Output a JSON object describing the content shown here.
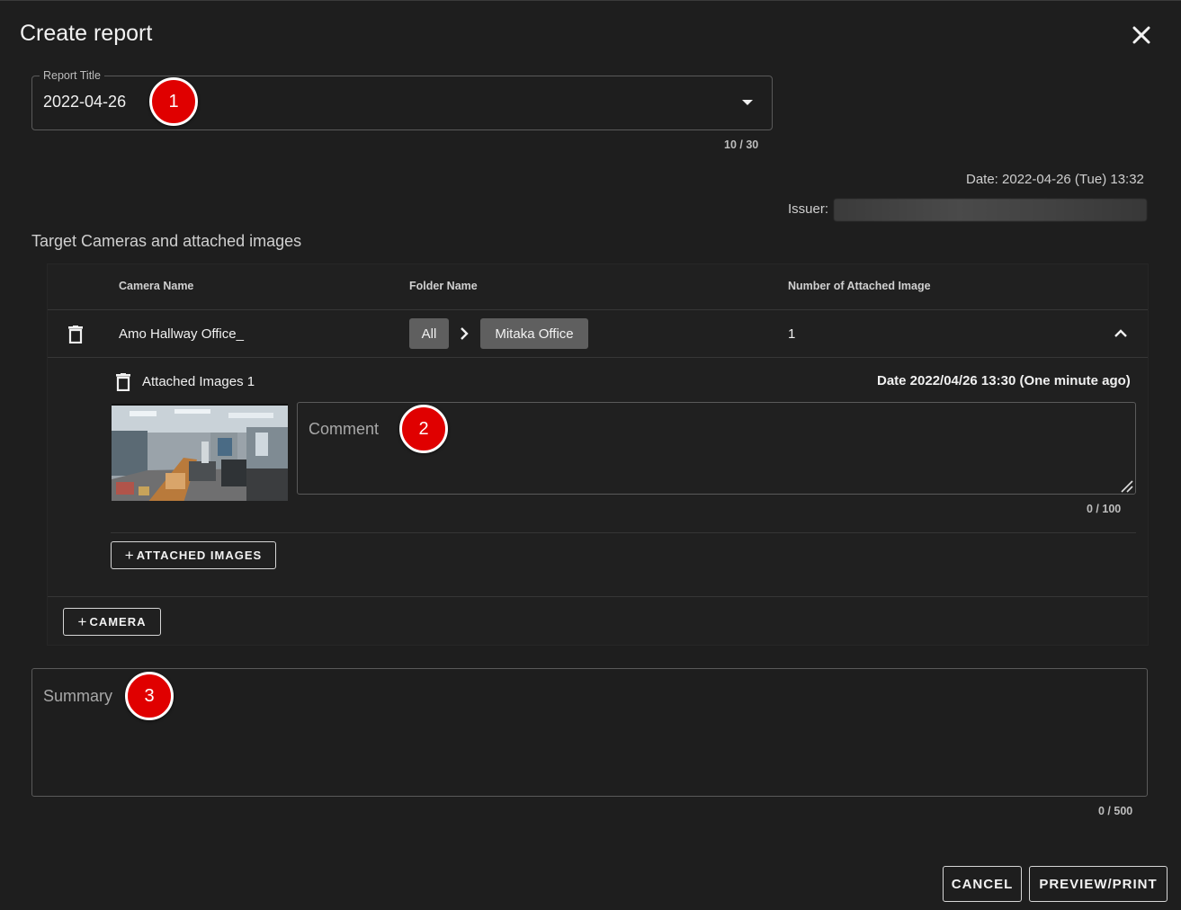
{
  "dialog": {
    "title": "Create report"
  },
  "report_title": {
    "legend": "Report Title",
    "value": "2022-04-26",
    "counter": "10 / 30"
  },
  "meta": {
    "date": "Date: 2022-04-26 (Tue) 13:32",
    "issuer_label": "Issuer:"
  },
  "section": {
    "label": "Target Cameras and attached images"
  },
  "table": {
    "headers": {
      "camera_name": "Camera Name",
      "folder_name": "Folder Name",
      "attached_count": "Number of Attached Image"
    },
    "rows": [
      {
        "camera_name": "Amo Hallway Office_",
        "folder_path": [
          "All",
          "Mitaka Office"
        ],
        "attached_count": "1",
        "attached_label": "Attached Images 1",
        "image_date": "Date 2022/04/26 13:30 (One minute ago)",
        "comment_placeholder": "Comment",
        "comment_counter": "0 / 100"
      }
    ],
    "add_images_label": "ATTACHED IMAGES",
    "add_camera_label": "CAMERA"
  },
  "summary": {
    "placeholder": "Summary",
    "counter": "0 / 500"
  },
  "footer": {
    "cancel_label": "CANCEL",
    "preview_label": "PREVIEW/PRINT"
  },
  "callouts": [
    "1",
    "2",
    "3"
  ],
  "colors": {
    "background": "#1e1e1e",
    "callout": "#e00000",
    "chip": "#5f5f5f",
    "border": "#5a5a5a"
  }
}
